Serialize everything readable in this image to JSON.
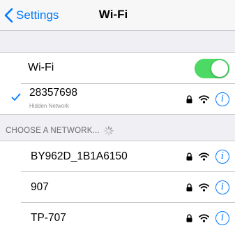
{
  "nav": {
    "back_label": "Settings",
    "title": "Wi-Fi"
  },
  "wifi_toggle": {
    "label": "Wi-Fi",
    "on": true
  },
  "connected": {
    "name": "28357698",
    "sublabel": "Hidden Network",
    "secured": true
  },
  "section_header": "CHOOSE A NETWORK...",
  "networks": [
    {
      "name": "BY962D_1B1A6150",
      "secured": true
    },
    {
      "name": "907",
      "secured": true
    },
    {
      "name": "TP-707",
      "secured": true
    }
  ],
  "info_glyph": "i",
  "colors": {
    "accent": "#007aff",
    "toggle_on": "#4cd964",
    "background": "#efeff4"
  },
  "icons": [
    "chevron-left-icon",
    "checkmark-icon",
    "lock-icon",
    "wifi-icon",
    "info-icon",
    "spinner-icon"
  ]
}
